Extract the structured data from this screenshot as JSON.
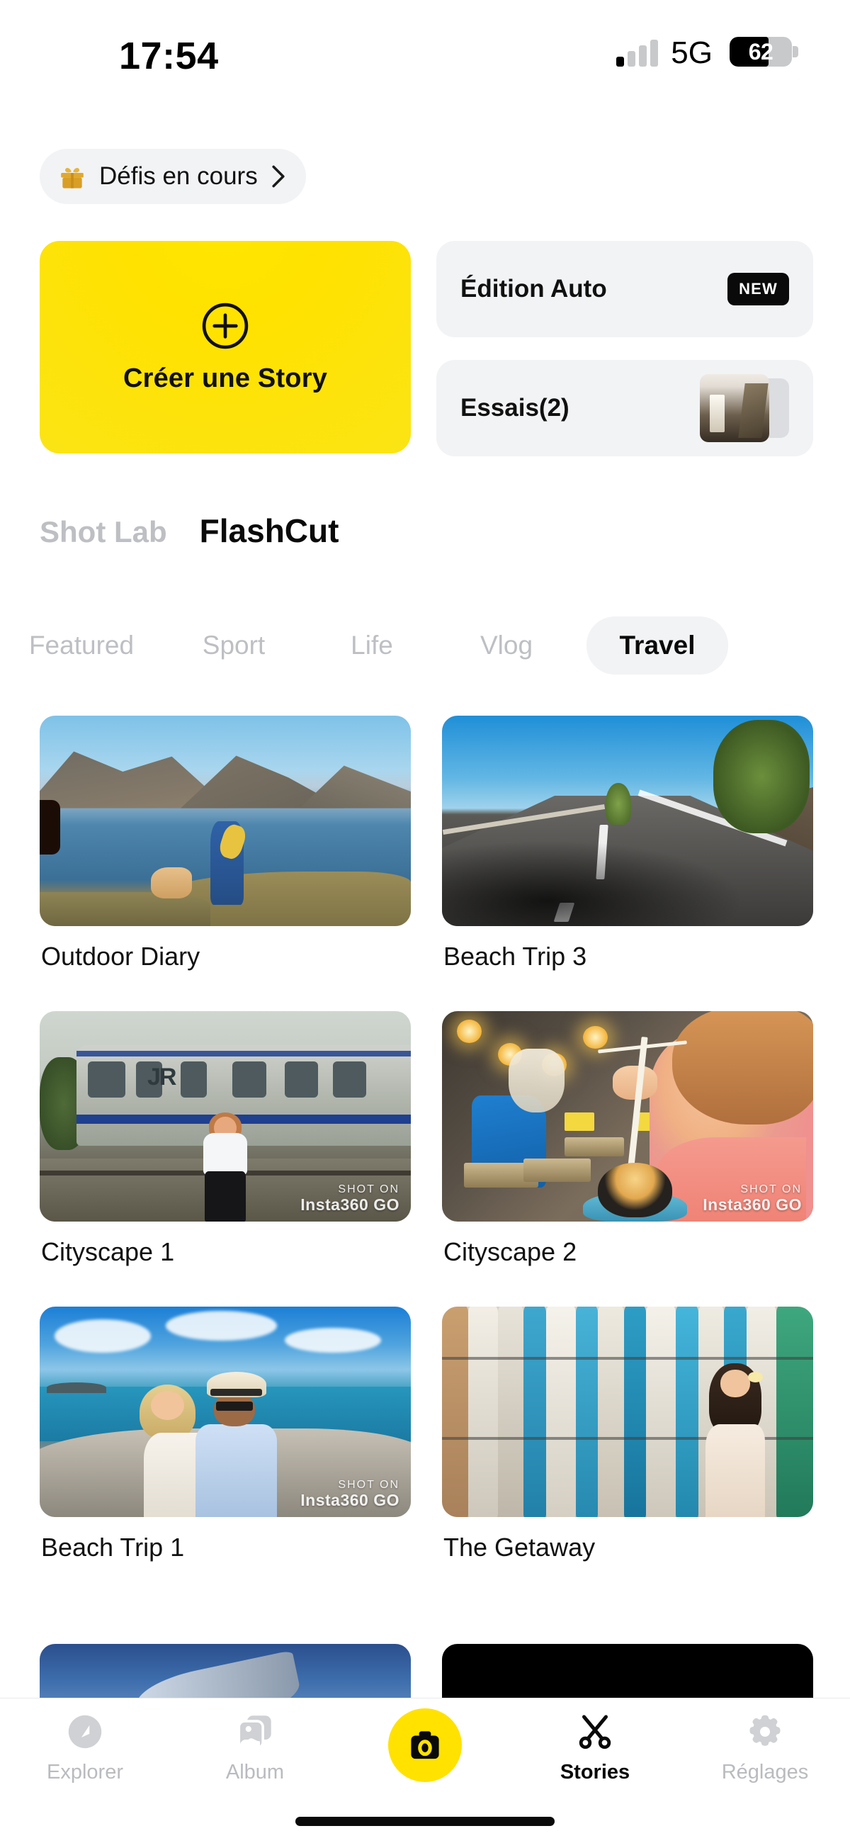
{
  "status_bar": {
    "time": "17:54",
    "network": "5G",
    "battery_percent": "62",
    "battery_level": 62,
    "signal_bars_filled": 1,
    "signal_bars_total": 4,
    "icons": [
      "signal-bars-icon",
      "battery-icon"
    ]
  },
  "challenge": {
    "label": "Défis en cours",
    "icon": "gift-icon",
    "chevron": "chevron-right-icon",
    "accent_color": "#D9A02B"
  },
  "create_card": {
    "label": "Créer une Story",
    "icon": "plus-circle-icon",
    "background_color": "#FBE415"
  },
  "side_cards": [
    {
      "title": "Édition Auto",
      "badge": "NEW",
      "badge_color": "#0A0A0A"
    },
    {
      "title": "Essais(2)",
      "thumbnail": "room-interior-thumbnail"
    }
  ],
  "section_tabs": [
    {
      "label": "Shot Lab",
      "active": false
    },
    {
      "label": "FlashCut",
      "active": true
    }
  ],
  "category_tabs": [
    {
      "label": "Featured",
      "active": false
    },
    {
      "label": "Sport",
      "active": false
    },
    {
      "label": "Life",
      "active": false
    },
    {
      "label": "Vlog",
      "active": false
    },
    {
      "label": "Travel",
      "active": true
    }
  ],
  "templates": [
    {
      "title": "Outdoor Diary",
      "scene": "mountain-lake-hiker-dog",
      "watermark": null
    },
    {
      "title": "Beach Trip 3",
      "scene": "open-road-pov",
      "watermark": null
    },
    {
      "title": "Cityscape 1",
      "scene": "jr-train-station-girl",
      "watermark": {
        "line1": "SHOT ON",
        "line2": "Insta360 GO"
      }
    },
    {
      "title": "Cityscape 2",
      "scene": "street-market-food-girl",
      "watermark": {
        "line1": "SHOT ON",
        "line2": "Insta360 GO"
      }
    },
    {
      "title": "Beach Trip 1",
      "scene": "couple-selfie-seaside",
      "watermark": {
        "line1": "SHOT ON",
        "line2": "Insta360 GO"
      }
    },
    {
      "title": "The Getaway",
      "scene": "surfboard-rack-girl",
      "watermark": null
    }
  ],
  "partial_row": [
    {
      "scene": "ocean-water-surfer"
    },
    {
      "scene": "black-frame"
    }
  ],
  "tab_bar": [
    {
      "label": "Explorer",
      "icon": "compass-icon",
      "active": false
    },
    {
      "label": "Album",
      "icon": "photos-icon",
      "active": false
    },
    {
      "label": "",
      "icon": "camera-icon",
      "active": false,
      "is_capture": true
    },
    {
      "label": "Stories",
      "icon": "scissors-icon",
      "active": true
    },
    {
      "label": "Réglages",
      "icon": "gear-icon",
      "active": false
    }
  ],
  "theme": {
    "brand_yellow": "#FFE200",
    "card_gray": "#F2F3F5",
    "text_primary": "#111111",
    "text_muted": "#BDBFC3"
  }
}
